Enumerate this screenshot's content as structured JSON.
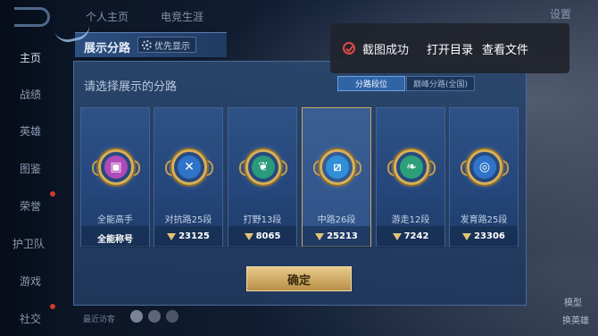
{
  "left_nav": {
    "items": [
      {
        "label": "主页",
        "active": true
      },
      {
        "label": "战绩"
      },
      {
        "label": "英雄"
      },
      {
        "label": "图鉴"
      },
      {
        "label": "荣誉"
      },
      {
        "label": "护卫队"
      },
      {
        "label": "游戏"
      },
      {
        "label": "社交"
      }
    ]
  },
  "top_tabs": [
    "个人主页",
    "电竞生涯"
  ],
  "settings_label": "设置",
  "modal": {
    "title": "展示分路",
    "priority_button": "优先显示",
    "subtitle": "请选择展示的分路",
    "segments": [
      {
        "label": "分路段位",
        "active": true
      },
      {
        "label": "巅峰分路(全国)",
        "active": false
      }
    ],
    "cards": [
      {
        "label": "全能高手",
        "score": "全能称号",
        "star": false,
        "color": "#b04ab8",
        "glyph": "▣"
      },
      {
        "label": "对抗路25段",
        "score": "23125",
        "star": true,
        "color": "#2f74c9",
        "glyph": "✕"
      },
      {
        "label": "打野13段",
        "score": "8065",
        "star": true,
        "color": "#2a9a7a",
        "glyph": "❦"
      },
      {
        "label": "中路26段",
        "score": "25213",
        "star": true,
        "color": "#2f8fd8",
        "glyph": "⧄",
        "selected": true
      },
      {
        "label": "游走12段",
        "score": "7242",
        "star": true,
        "color": "#2da079",
        "glyph": "❧"
      },
      {
        "label": "发育路25段",
        "score": "23306",
        "star": true,
        "color": "#2f74c9",
        "glyph": "◎"
      }
    ],
    "confirm_label": "确定"
  },
  "toast": {
    "message": "截图成功",
    "open_dir": "打开目录",
    "view_file": "查看文件"
  },
  "bottom": {
    "visitor_text": "最近访客"
  },
  "right_labels": {
    "mode": "模型",
    "change_hero": "换英雄"
  }
}
